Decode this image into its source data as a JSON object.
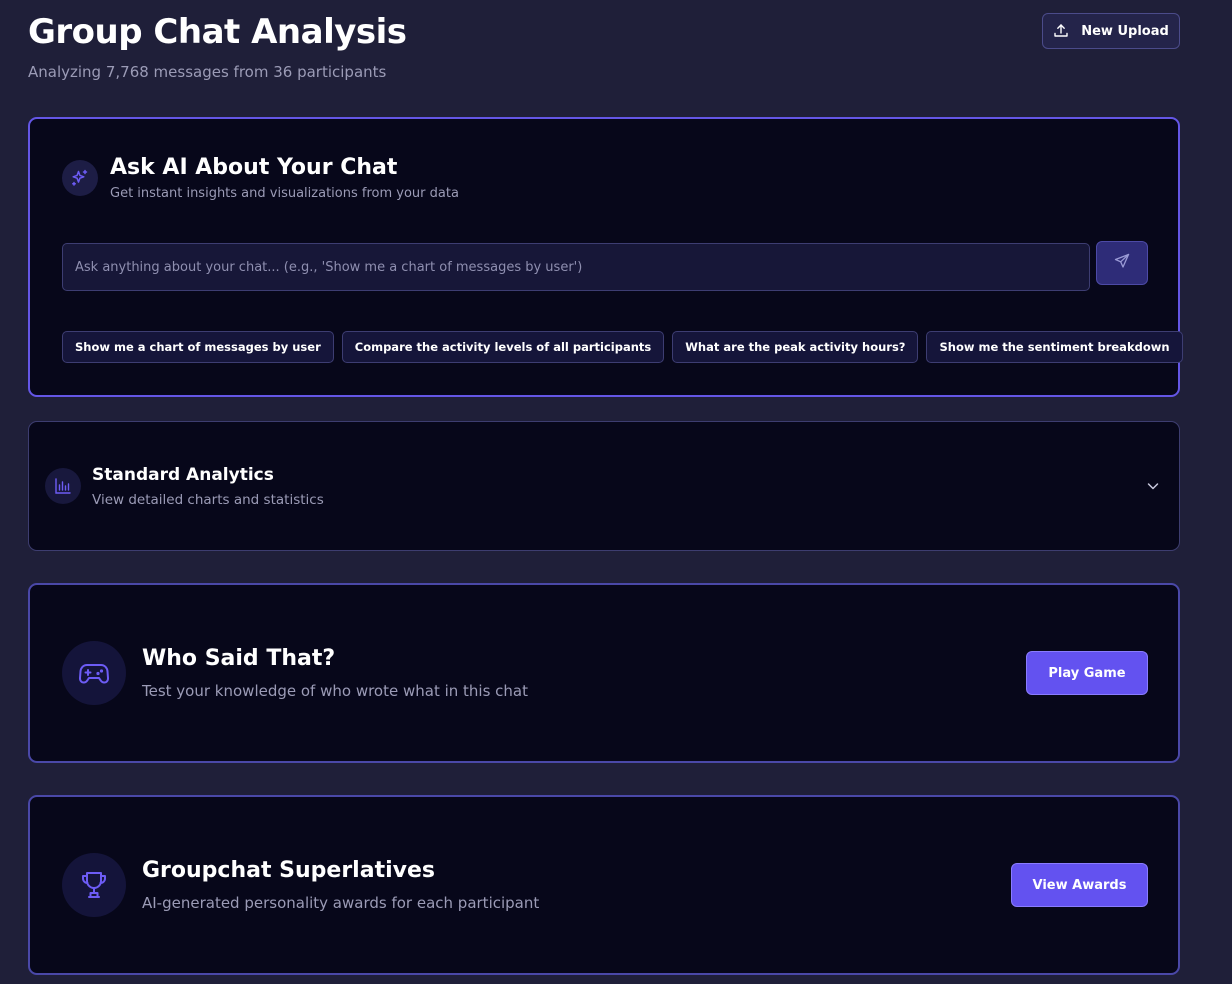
{
  "header": {
    "title": "Group Chat Analysis",
    "subtitle": "Analyzing 7,768 messages from 36 participants",
    "upload_button": {
      "label": "New Upload",
      "icon": "upload-icon"
    }
  },
  "ask_ai": {
    "icon": "sparkles-icon",
    "title": "Ask AI About Your Chat",
    "description": "Get instant insights and visualizations from your data",
    "input": {
      "value": "",
      "placeholder": "Ask anything about your chat... (e.g., 'Show me a chart of messages by user')"
    },
    "send_icon": "send-icon",
    "suggestions": [
      "Show me a chart of messages by user",
      "Compare the activity levels of all participants",
      "What are the peak activity hours?",
      "Show me the sentiment breakdown"
    ]
  },
  "standard_analytics": {
    "icon": "bar-chart-icon",
    "title": "Standard Analytics",
    "description": "View detailed charts and statistics",
    "toggle_icon": "chevron-down-icon"
  },
  "game": {
    "icon": "gamepad-icon",
    "title": "Who Said That?",
    "description": "Test your knowledge of who wrote what in this chat",
    "button_label": "Play Game"
  },
  "superlatives": {
    "icon": "trophy-icon",
    "title": "Groupchat Superlatives",
    "description": "AI-generated personality awards for each participant",
    "button_label": "View Awards"
  },
  "colors": {
    "background": "#1f1f39",
    "card": "#07071a",
    "accent": "#6352f0",
    "accent_border": "#6456e6",
    "muted_text": "#9b9bb6"
  }
}
